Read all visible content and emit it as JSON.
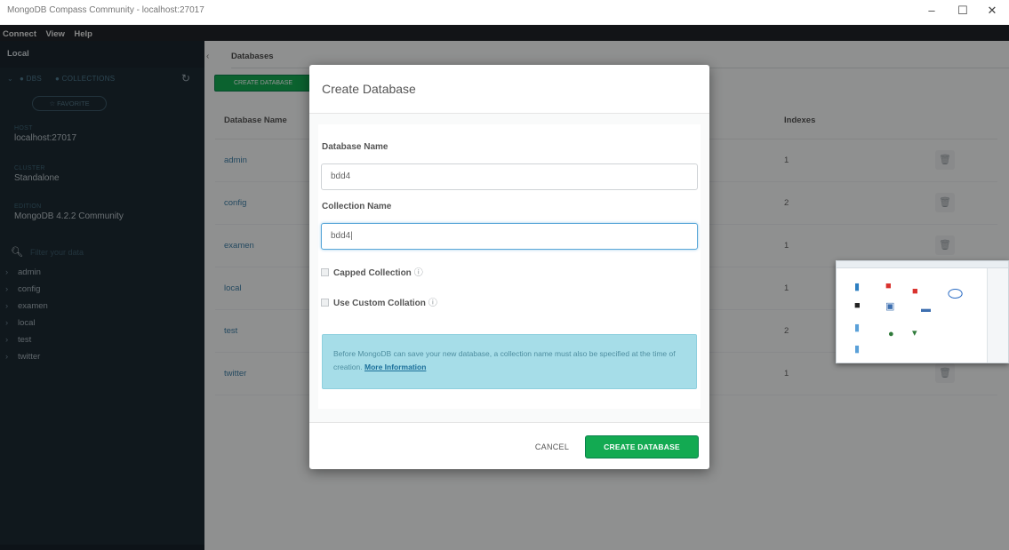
{
  "window": {
    "title": "MongoDB Compass Community - localhost:27017",
    "minimize_glyph": "–",
    "maximize_glyph": "☐",
    "close_glyph": "✕"
  },
  "menu": [
    "Connect",
    "View",
    "Help"
  ],
  "sidebar": {
    "connection_label": "Local",
    "tabs": [
      "DBS",
      "COLLECTIONS"
    ],
    "favorite_button": "FAVORITE",
    "info": [
      {
        "label": "HOST",
        "value": "localhost:27017"
      },
      {
        "label": "CLUSTER",
        "value": "Standalone"
      },
      {
        "label": "EDITION",
        "value": "MongoDB 4.2.2 Community"
      }
    ],
    "filter_placeholder": "Filter your data",
    "databases": [
      "admin",
      "config",
      "examen",
      "local",
      "test",
      "twitter"
    ]
  },
  "main": {
    "tab_label": "Databases",
    "create_button": "CREATE DATABASE",
    "columns": {
      "name": "Database Name",
      "indexes": "Indexes"
    },
    "rows": [
      {
        "name": "admin",
        "indexes": "1"
      },
      {
        "name": "config",
        "indexes": "2"
      },
      {
        "name": "examen",
        "indexes": "1"
      },
      {
        "name": "local",
        "indexes": "1"
      },
      {
        "name": "test",
        "indexes": "2"
      },
      {
        "name": "twitter",
        "indexes": "1"
      }
    ]
  },
  "modal": {
    "title": "Create Database",
    "database_name_label": "Database Name",
    "database_name_value": "bdd4",
    "collection_name_label": "Collection Name",
    "collection_name_value": "bdd4",
    "capped_label": "Capped Collection",
    "custom_collation_label": "Use Custom Collation",
    "info_glyph": "ⓘ",
    "notice_text": "Before MongoDB can save your new database, a collection name must also be specified at the time of creation.",
    "notice_link": "More Information",
    "cancel_label": "CANCEL",
    "create_label": "CREATE DATABASE"
  },
  "colors": {
    "accent_green": "#13aa52",
    "sidebar_bg": "#1d2a33",
    "notice_bg": "#a6dde8",
    "link_blue": "#3f7fa6"
  }
}
